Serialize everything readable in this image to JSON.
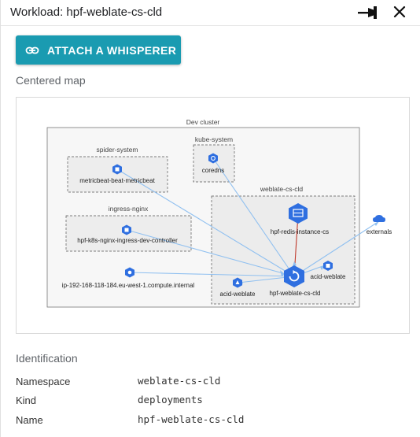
{
  "window": {
    "title": "Workload: hpf-weblate-cs-cld"
  },
  "toolbar": {
    "pin_icon": "pin-icon",
    "close_icon": "close-icon"
  },
  "attach_button": {
    "label": "ATTACH A WHISPERER",
    "icon": "link-icon",
    "color": "#1a9bb1"
  },
  "map": {
    "section_title": "Centered map",
    "cluster_label": "Dev cluster",
    "groups": {
      "spider_system": "spider-system",
      "kube_system": "kube-system",
      "ingress_nginx": "ingress-nginx",
      "weblate_cs_cld": "weblate-cs-cld"
    },
    "nodes": {
      "metricbeat": "metricbeat-beat-metricbeat",
      "coredns": "coredns",
      "ingress_controller": "hpf-k8s-nginx-ingress-dev-controller",
      "ip_node": "ip-192-168-118-184.eu-west-1.compute.internal",
      "redis": "hpf-redis-instance-cs",
      "acid_weblate_left": "acid-weblate",
      "hpf_weblate": "hpf-weblate-cs-cld",
      "acid_weblate_right": "acid-weblate",
      "externals": "externals"
    },
    "colors": {
      "node": "#2f6fe0",
      "edge": "#90c0f0",
      "redis_edge": "#c0392b"
    }
  },
  "identification": {
    "section_title": "Identification",
    "rows": [
      {
        "label": "Namespace",
        "value": "weblate-cs-cld"
      },
      {
        "label": "Kind",
        "value": "deployments"
      },
      {
        "label": "Name",
        "value": "hpf-weblate-cs-cld"
      }
    ]
  }
}
